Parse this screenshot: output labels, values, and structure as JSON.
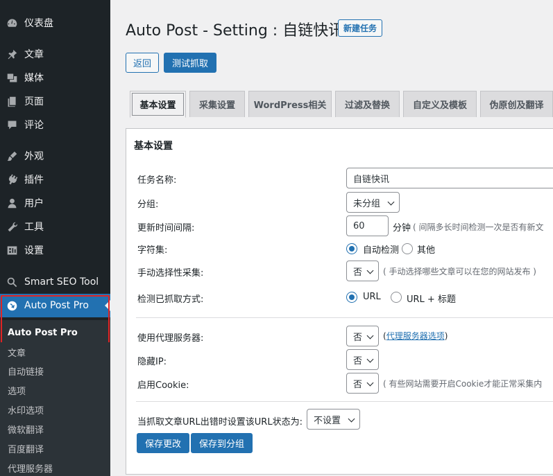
{
  "sidebar": {
    "items": [
      {
        "label": "仪表盘",
        "icon": "dashboard-icon"
      },
      {
        "label": "文章",
        "icon": "pin-icon"
      },
      {
        "label": "媒体",
        "icon": "media-icon"
      },
      {
        "label": "页面",
        "icon": "page-icon"
      },
      {
        "label": "评论",
        "icon": "comment-icon"
      },
      {
        "label": "外观",
        "icon": "brush-icon"
      },
      {
        "label": "插件",
        "icon": "plugin-icon"
      },
      {
        "label": "用户",
        "icon": "user-icon"
      },
      {
        "label": "工具",
        "icon": "wrench-icon"
      },
      {
        "label": "设置",
        "icon": "settings-icon"
      },
      {
        "label": "Smart SEO Tool",
        "icon": "seo-icon"
      },
      {
        "label": "Auto Post Pro",
        "icon": "auto-post-icon"
      }
    ],
    "submenu_current": "Auto Post Pro",
    "submenu": [
      "文章",
      "自动链接",
      "选项",
      "水印选项",
      "微软翻译",
      "百度翻译",
      "代理服务器"
    ]
  },
  "header": {
    "title": "Auto Post - Setting : 自链快讯",
    "new_task": "新建任务",
    "back": "返回",
    "test_fetch": "测试抓取"
  },
  "tabs": [
    "基本设置",
    "采集设置",
    "WordPress相关",
    "过滤及替换",
    "自定义及模板",
    "伪原创及翻译"
  ],
  "panel": {
    "title": "基本设置",
    "task_name_label": "任务名称:",
    "task_name_value": "自链快讯",
    "group_label": "分组:",
    "group_value": "未分组",
    "interval_label": "更新时间间隔:",
    "interval_value": "60",
    "interval_unit": "分钟",
    "interval_hint": "( 间隔多长时间检测一次是否有新文",
    "charset_label": "字符集:",
    "charset_auto": "自动检测",
    "charset_other": "其他",
    "manual_label": "手动选择性采集:",
    "manual_value": "否",
    "manual_hint": "( 手动选择哪些文章可以在您的网站发布 )",
    "detect_label": "检测已抓取方式:",
    "detect_url": "URL",
    "detect_url_title": "URL + 标题",
    "proxy_label": "使用代理服务器:",
    "proxy_value": "否",
    "proxy_link_open": "(",
    "proxy_link": "代理服务器选项",
    "proxy_link_close": ")",
    "hide_ip_label": "隐藏IP:",
    "hide_ip_value": "否",
    "cookie_label": "启用Cookie:",
    "cookie_value": "否",
    "cookie_hint": "( 有些网站需要开启Cookie才能正常采集内",
    "error_label": "当抓取文章URL出错时设置该URL状态为:",
    "error_value": "不设置",
    "save": "保存更改",
    "save_group": "保存到分组"
  },
  "colors": {
    "accent": "#2271b1",
    "sidebar": "#1d2327",
    "highlight": "#e02424"
  }
}
